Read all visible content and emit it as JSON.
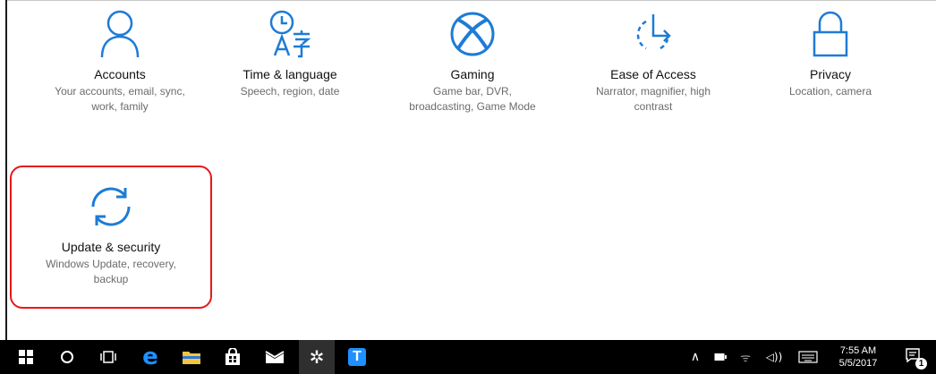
{
  "tiles": [
    {
      "title": "Accounts",
      "desc_line1": "Your accounts, email, sync,",
      "desc_line2": "work, family",
      "icon": "person-icon"
    },
    {
      "title": "Time & language",
      "desc_line1": "Speech, region, date",
      "desc_line2": "",
      "icon": "time-language-icon"
    },
    {
      "title": "Gaming",
      "desc_line1": "Game bar, DVR,",
      "desc_line2": "broadcasting, Game Mode",
      "icon": "xbox-icon"
    },
    {
      "title": "Ease of Access",
      "desc_line1": "Narrator, magnifier, high",
      "desc_line2": "contrast",
      "icon": "ease-of-access-icon"
    },
    {
      "title": "Privacy",
      "desc_line1": "Location, camera",
      "desc_line2": "",
      "icon": "lock-icon"
    },
    {
      "title": "Update & security",
      "desc_line1": "Windows Update, recovery,",
      "desc_line2": "backup",
      "icon": "sync-icon"
    }
  ],
  "taskbar": {
    "time": "7:55 AM",
    "date": "5/5/2017",
    "notification_count": "1",
    "icons": [
      "windows-start-icon",
      "cortana-icon",
      "task-view-icon",
      "edge-icon",
      "file-explorer-icon",
      "store-icon",
      "mail-icon",
      "settings-icon",
      "app-t-icon"
    ],
    "tray_icons": [
      "chevron-up-icon",
      "battery-icon",
      "wifi-icon",
      "volume-icon",
      "keyboard-icon",
      "action-center-icon"
    ]
  },
  "colors": {
    "accent": "#1e7bd6",
    "highlight": "#e81818",
    "taskbar": "#000000"
  }
}
